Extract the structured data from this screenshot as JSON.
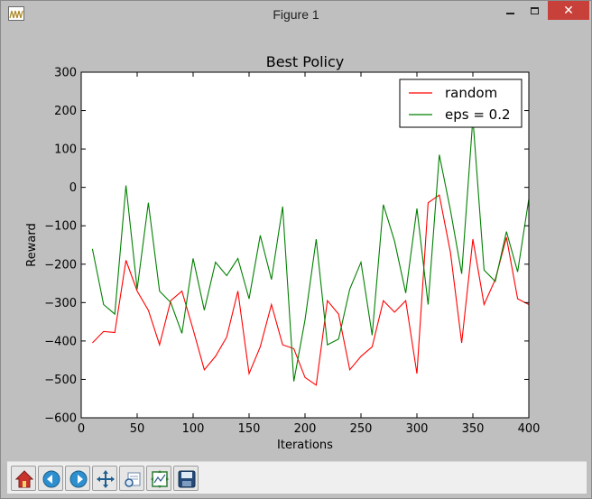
{
  "window": {
    "title": "Figure 1",
    "close_glyph": "✕"
  },
  "toolbar": {
    "buttons": [
      {
        "name": "home-icon"
      },
      {
        "name": "back-icon"
      },
      {
        "name": "forward-icon"
      },
      {
        "name": "pan-icon"
      },
      {
        "name": "zoom-icon"
      },
      {
        "name": "subplots-icon"
      },
      {
        "name": "save-icon"
      }
    ]
  },
  "chart_data": {
    "type": "line",
    "title": "Best Policy",
    "xlabel": "Iterations",
    "ylabel": "Reward",
    "xlim": [
      0,
      400
    ],
    "ylim": [
      -600,
      300
    ],
    "xticks": [
      0,
      50,
      100,
      150,
      200,
      250,
      300,
      350,
      400
    ],
    "yticks": [
      -600,
      -500,
      -400,
      -300,
      -200,
      -100,
      0,
      100,
      200,
      300
    ],
    "grid": false,
    "legend_position": "top-right",
    "x": [
      10,
      20,
      30,
      40,
      50,
      60,
      70,
      80,
      90,
      100,
      110,
      120,
      130,
      140,
      150,
      160,
      170,
      180,
      190,
      200,
      210,
      220,
      230,
      240,
      250,
      260,
      270,
      280,
      290,
      300,
      310,
      320,
      330,
      340,
      350,
      360,
      370,
      380,
      390,
      400
    ],
    "series": [
      {
        "name": "random",
        "color": "#ff0000",
        "values": [
          -405,
          -375,
          -378,
          -190,
          -270,
          -320,
          -410,
          -295,
          -270,
          -370,
          -475,
          -440,
          -390,
          -270,
          -485,
          -415,
          -305,
          -410,
          -420,
          -495,
          -515,
          -295,
          -330,
          -475,
          -440,
          -415,
          -295,
          -325,
          -295,
          -485,
          -40,
          -20,
          -170,
          -405,
          -135,
          -305,
          -240,
          -130,
          -290,
          -305
        ]
      },
      {
        "name": "eps = 0.2",
        "color": "#008000",
        "values": [
          -160,
          -305,
          -330,
          5,
          -265,
          -40,
          -270,
          -300,
          -380,
          -185,
          -320,
          -195,
          -230,
          -185,
          -290,
          -125,
          -240,
          -50,
          -505,
          -345,
          -135,
          -410,
          -395,
          -265,
          -195,
          -385,
          -45,
          -140,
          -275,
          -55,
          -305,
          85,
          -60,
          -225,
          180,
          -215,
          -245,
          -115,
          -220,
          -30
        ]
      }
    ]
  }
}
